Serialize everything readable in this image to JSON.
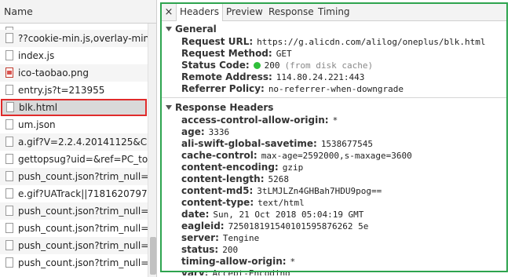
{
  "list": {
    "header": "Name",
    "items": [
      {
        "name": "",
        "icon": "doc",
        "partial": true
      },
      {
        "name": "??cookie-min.js,overlay-min.js,...",
        "icon": "doc"
      },
      {
        "name": "index.js",
        "icon": "doc"
      },
      {
        "name": "ico-taobao.png",
        "icon": "img"
      },
      {
        "name": "entry.js?t=213955",
        "icon": "doc"
      },
      {
        "name": "blk.html",
        "icon": "doc",
        "selected": true
      },
      {
        "name": "um.json",
        "icon": "doc"
      },
      {
        "name": "a.gif?V=2.2.4.20141125&CI=s...",
        "icon": "doc"
      },
      {
        "name": "gettopsug?uid=&ref=PC_tops...",
        "icon": "doc"
      },
      {
        "name": "push_count.json?trim_null=1...",
        "icon": "doc"
      },
      {
        "name": "e.gif?UATrack||718162079757...",
        "icon": "doc"
      },
      {
        "name": "push_count.json?trim_null=1...",
        "icon": "doc"
      },
      {
        "name": "push_count.json?trim_null=1...",
        "icon": "doc"
      },
      {
        "name": "push_count.json?trim_null=1...",
        "icon": "doc"
      },
      {
        "name": "push_count.json?trim_null=1...",
        "icon": "doc"
      }
    ]
  },
  "tabs": {
    "close": "×",
    "headers": "Headers",
    "preview": "Preview",
    "response": "Response",
    "timing": "Timing"
  },
  "general": {
    "title": "General",
    "request_url_key": "Request URL:",
    "request_url": "https://g.alicdn.com/alilog/oneplus/blk.html",
    "request_method_key": "Request Method:",
    "request_method": "GET",
    "status_code_key": "Status Code:",
    "status_code": "200",
    "status_note": "(from disk cache)",
    "remote_address_key": "Remote Address:",
    "remote_address": "114.80.24.221:443",
    "referrer_policy_key": "Referrer Policy:",
    "referrer_policy": "no-referrer-when-downgrade"
  },
  "response_headers": {
    "title": "Response Headers",
    "items": [
      {
        "k": "access-control-allow-origin:",
        "v": "*"
      },
      {
        "k": "age:",
        "v": "3336"
      },
      {
        "k": "ali-swift-global-savetime:",
        "v": "1538677545"
      },
      {
        "k": "cache-control:",
        "v": "max-age=2592000,s-maxage=3600"
      },
      {
        "k": "content-encoding:",
        "v": "gzip"
      },
      {
        "k": "content-length:",
        "v": "5268"
      },
      {
        "k": "content-md5:",
        "v": "3tLMJLZn4GHBah7HDU9pog=="
      },
      {
        "k": "content-type:",
        "v": "text/html"
      },
      {
        "k": "date:",
        "v": "Sun, 21 Oct 2018 05:04:19 GMT"
      },
      {
        "k": "eagleid:",
        "v": "725018191540101595876262 5e"
      },
      {
        "k": "server:",
        "v": "Tengine"
      },
      {
        "k": "status:",
        "v": "200"
      },
      {
        "k": "timing-allow-origin:",
        "v": "*"
      },
      {
        "k": "vary:",
        "v": "Accept-Encoding"
      }
    ]
  },
  "colors": {
    "status_dot": "#2fbf3a",
    "selected_outline": "#e02b2b",
    "panel_frame": "#2ea44f"
  }
}
